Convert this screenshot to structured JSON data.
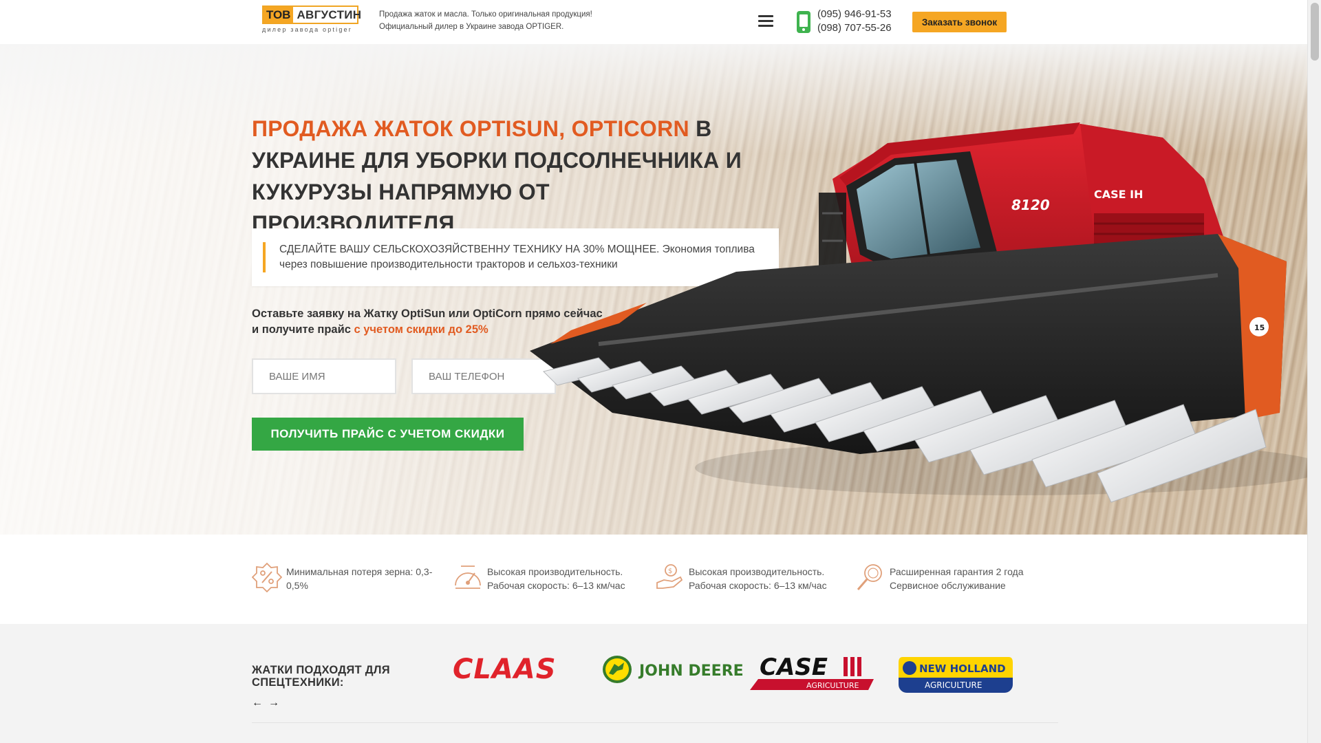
{
  "header": {
    "logo_tov": "ТОВ",
    "logo_name": "АВГУСТИН",
    "logo_sub": "дилер завода OPTIGER",
    "tagline_line1": "Продажа жаток и масла. Только оригинальная продукция!",
    "tagline_line2": "Официальный дилер в Украине завода OPTIGER.",
    "phone1": "(095) 946-91-53",
    "phone2": "(098) 707-55-26",
    "callback_label": "Заказать звонок",
    "menu_icon": "hamburger-icon",
    "phone_icon": "mobile-phone-icon"
  },
  "hero": {
    "title_accent": "ПРОДАЖА ЖАТОК OPTISUN, OPTICORN",
    "title_rest": " В УКРАИНЕ ДЛЯ УБОРКИ ПОДСОЛНЕЧНИКА И КУКУРУЗЫ НАПРЯМУЮ ОТ ПРОИЗВОДИТЕЛЯ",
    "quote": "СДЕЛАЙТЕ ВАШУ СЕЛЬСКОХОЗЯЙСТВЕННУ ТЕХНИКУ НА 30% МОЩНЕЕ. Экономия топлива через повышение производительности тракторов и сельхоз-техники",
    "offer_line1": "Оставьте заявку на Жатку OptiSun или OptiCorn прямо сейчас",
    "offer_line2": "и получите прайс ",
    "offer_accent": "с учетом скидки до 25%",
    "name_placeholder": "ВАШЕ ИМЯ",
    "phone_placeholder": "ВАШ ТЕЛЕФОН",
    "cta_label": "ПОЛУЧИТЬ ПРАЙС С УЧЕТОМ СКИДКИ",
    "combine_model": "8120",
    "combine_brand": "CASE IH"
  },
  "features": [
    {
      "icon": "percent-badge-icon",
      "text": "Минимальная потеря зерна: 0,3-0,5%"
    },
    {
      "icon": "speedometer-icon",
      "text": "Высокая производительность. Рабочая скорость: 6–13 км/час"
    },
    {
      "icon": "hand-coin-icon",
      "text": "Высокая производительность. Рабочая скорость: 6–13 км/час"
    },
    {
      "icon": "magnifier-search-icon",
      "text": "Расширенная гарантия 2 года Сервисное обслуживание"
    }
  ],
  "brands": {
    "title_line1": "ЖАТКИ ПОДХОДЯТ ДЛЯ",
    "title_line2": "СПЕЦТЕХНИКИ:",
    "prev_arrow": "←",
    "next_arrow": "→",
    "claas": "CLAAS",
    "john_deere": "JOHN DEERE",
    "case": "CASE",
    "case_sub": "AGRICULTURE",
    "new_holland": "NEW HOLLAND",
    "new_holland_sub": "AGRICULTURE"
  },
  "colors": {
    "accent_orange": "#e15b21",
    "brand_yellow": "#f5a623",
    "cta_green": "#34a744",
    "claas_red": "#e0232b",
    "jd_green": "#367c2b",
    "case_red": "#c8102e",
    "nh_blue": "#1d3f8f"
  }
}
